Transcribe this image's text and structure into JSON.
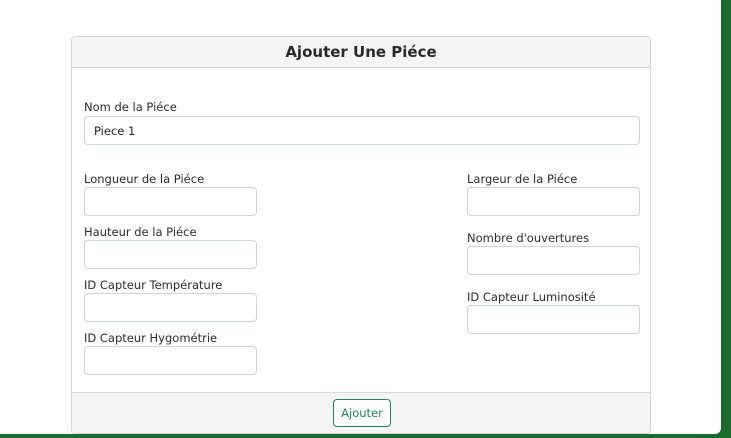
{
  "form": {
    "title": "Ajouter Une Piéce",
    "fields": {
      "nom": {
        "label": "Nom de la Piéce",
        "value": "Piece 1"
      },
      "longueur": {
        "label": "Longueur de la Piéce",
        "value": ""
      },
      "largeur": {
        "label": "Largeur de la Piéce",
        "value": ""
      },
      "hauteur": {
        "label": "Hauteur de la Piéce",
        "value": ""
      },
      "ouvertures": {
        "label": "Nombre d'ouvertures",
        "value": ""
      },
      "capteur_temperature": {
        "label": "ID Capteur Température",
        "value": ""
      },
      "capteur_luminosite": {
        "label": "ID Capteur Luminosité",
        "value": ""
      },
      "capteur_hygrometrie": {
        "label": "ID Capteur Hygométrie",
        "value": ""
      }
    },
    "submit_label": "Ajouter"
  },
  "colors": {
    "background": "#1b6b2c",
    "button_accent": "#198754"
  }
}
